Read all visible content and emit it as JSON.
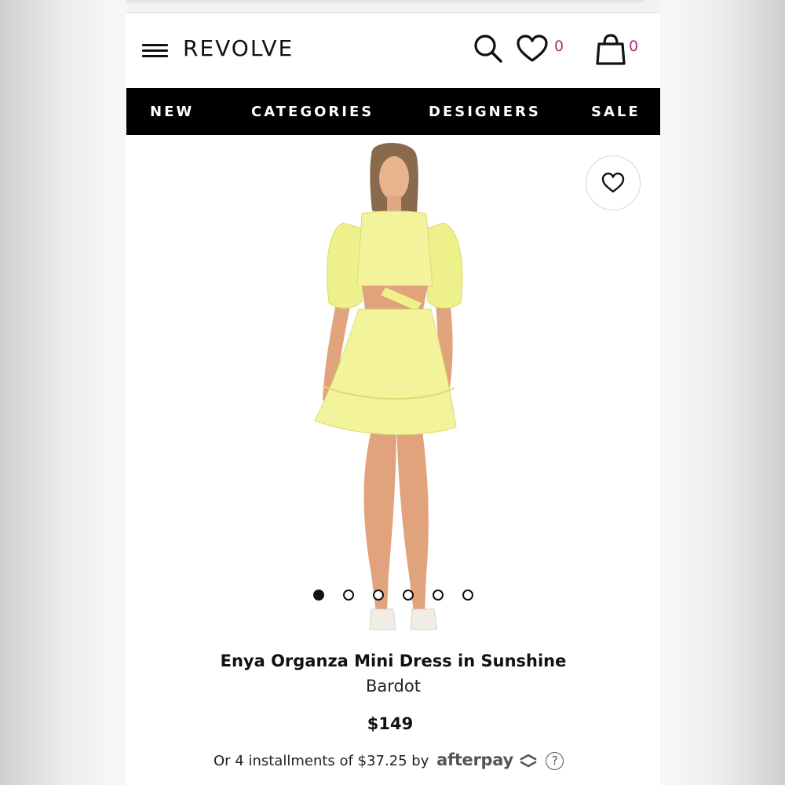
{
  "header": {
    "brand": "REVOLVE",
    "wishlist_count": "0",
    "bag_count": "0"
  },
  "nav": {
    "items": [
      "NEW",
      "CATEGORIES",
      "DESIGNERS",
      "SALE"
    ]
  },
  "product": {
    "name": "Enya Organza Mini Dress in Sunshine",
    "designer": "Bardot",
    "price": "$149",
    "image_count": 6,
    "active_image_index": 0,
    "dress_color": "#f2f39a"
  },
  "installments": {
    "text": "Or 4 installments of $37.25 by",
    "provider": "afterpay",
    "help_symbol": "?"
  },
  "colors": {
    "count_accent": "#a8317f",
    "nav_bg": "#000000"
  },
  "icons": [
    "hamburger-icon",
    "search-icon",
    "heart-icon",
    "bag-icon",
    "help-icon"
  ]
}
